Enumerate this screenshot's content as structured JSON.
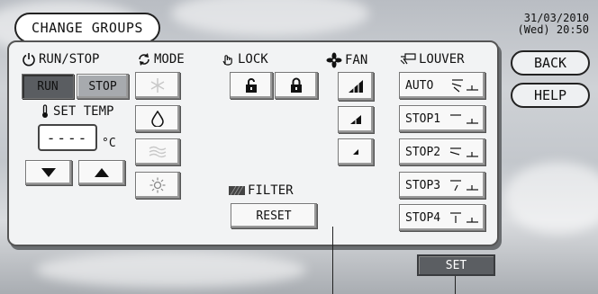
{
  "header": {
    "title": "CHANGE GROUPS",
    "date": "31/03/2010",
    "day_time": "(Wed) 20:50"
  },
  "side": {
    "back_label": "BACK",
    "help_label": "HELP"
  },
  "run_stop": {
    "heading": "RUN/STOP",
    "run_label": "RUN",
    "stop_label": "STOP",
    "selected": "RUN"
  },
  "set_temp": {
    "heading": "SET TEMP",
    "value": "----",
    "unit": "°C"
  },
  "mode": {
    "heading": "MODE",
    "items": [
      "cool-icon",
      "dry-icon",
      "fan-mode-icon",
      "heat-icon"
    ]
  },
  "lock": {
    "heading": "LOCK",
    "items": [
      "unlock-icon",
      "lock-icon"
    ]
  },
  "fan": {
    "heading": "FAN",
    "levels": [
      "high",
      "medium",
      "low"
    ]
  },
  "filter": {
    "heading": "FILTER",
    "reset_label": "RESET"
  },
  "louver": {
    "heading": "LOUVER",
    "items": [
      "AUTO",
      "STOP1",
      "STOP2",
      "STOP3",
      "STOP4"
    ]
  },
  "footer": {
    "set_label": "SET"
  }
}
